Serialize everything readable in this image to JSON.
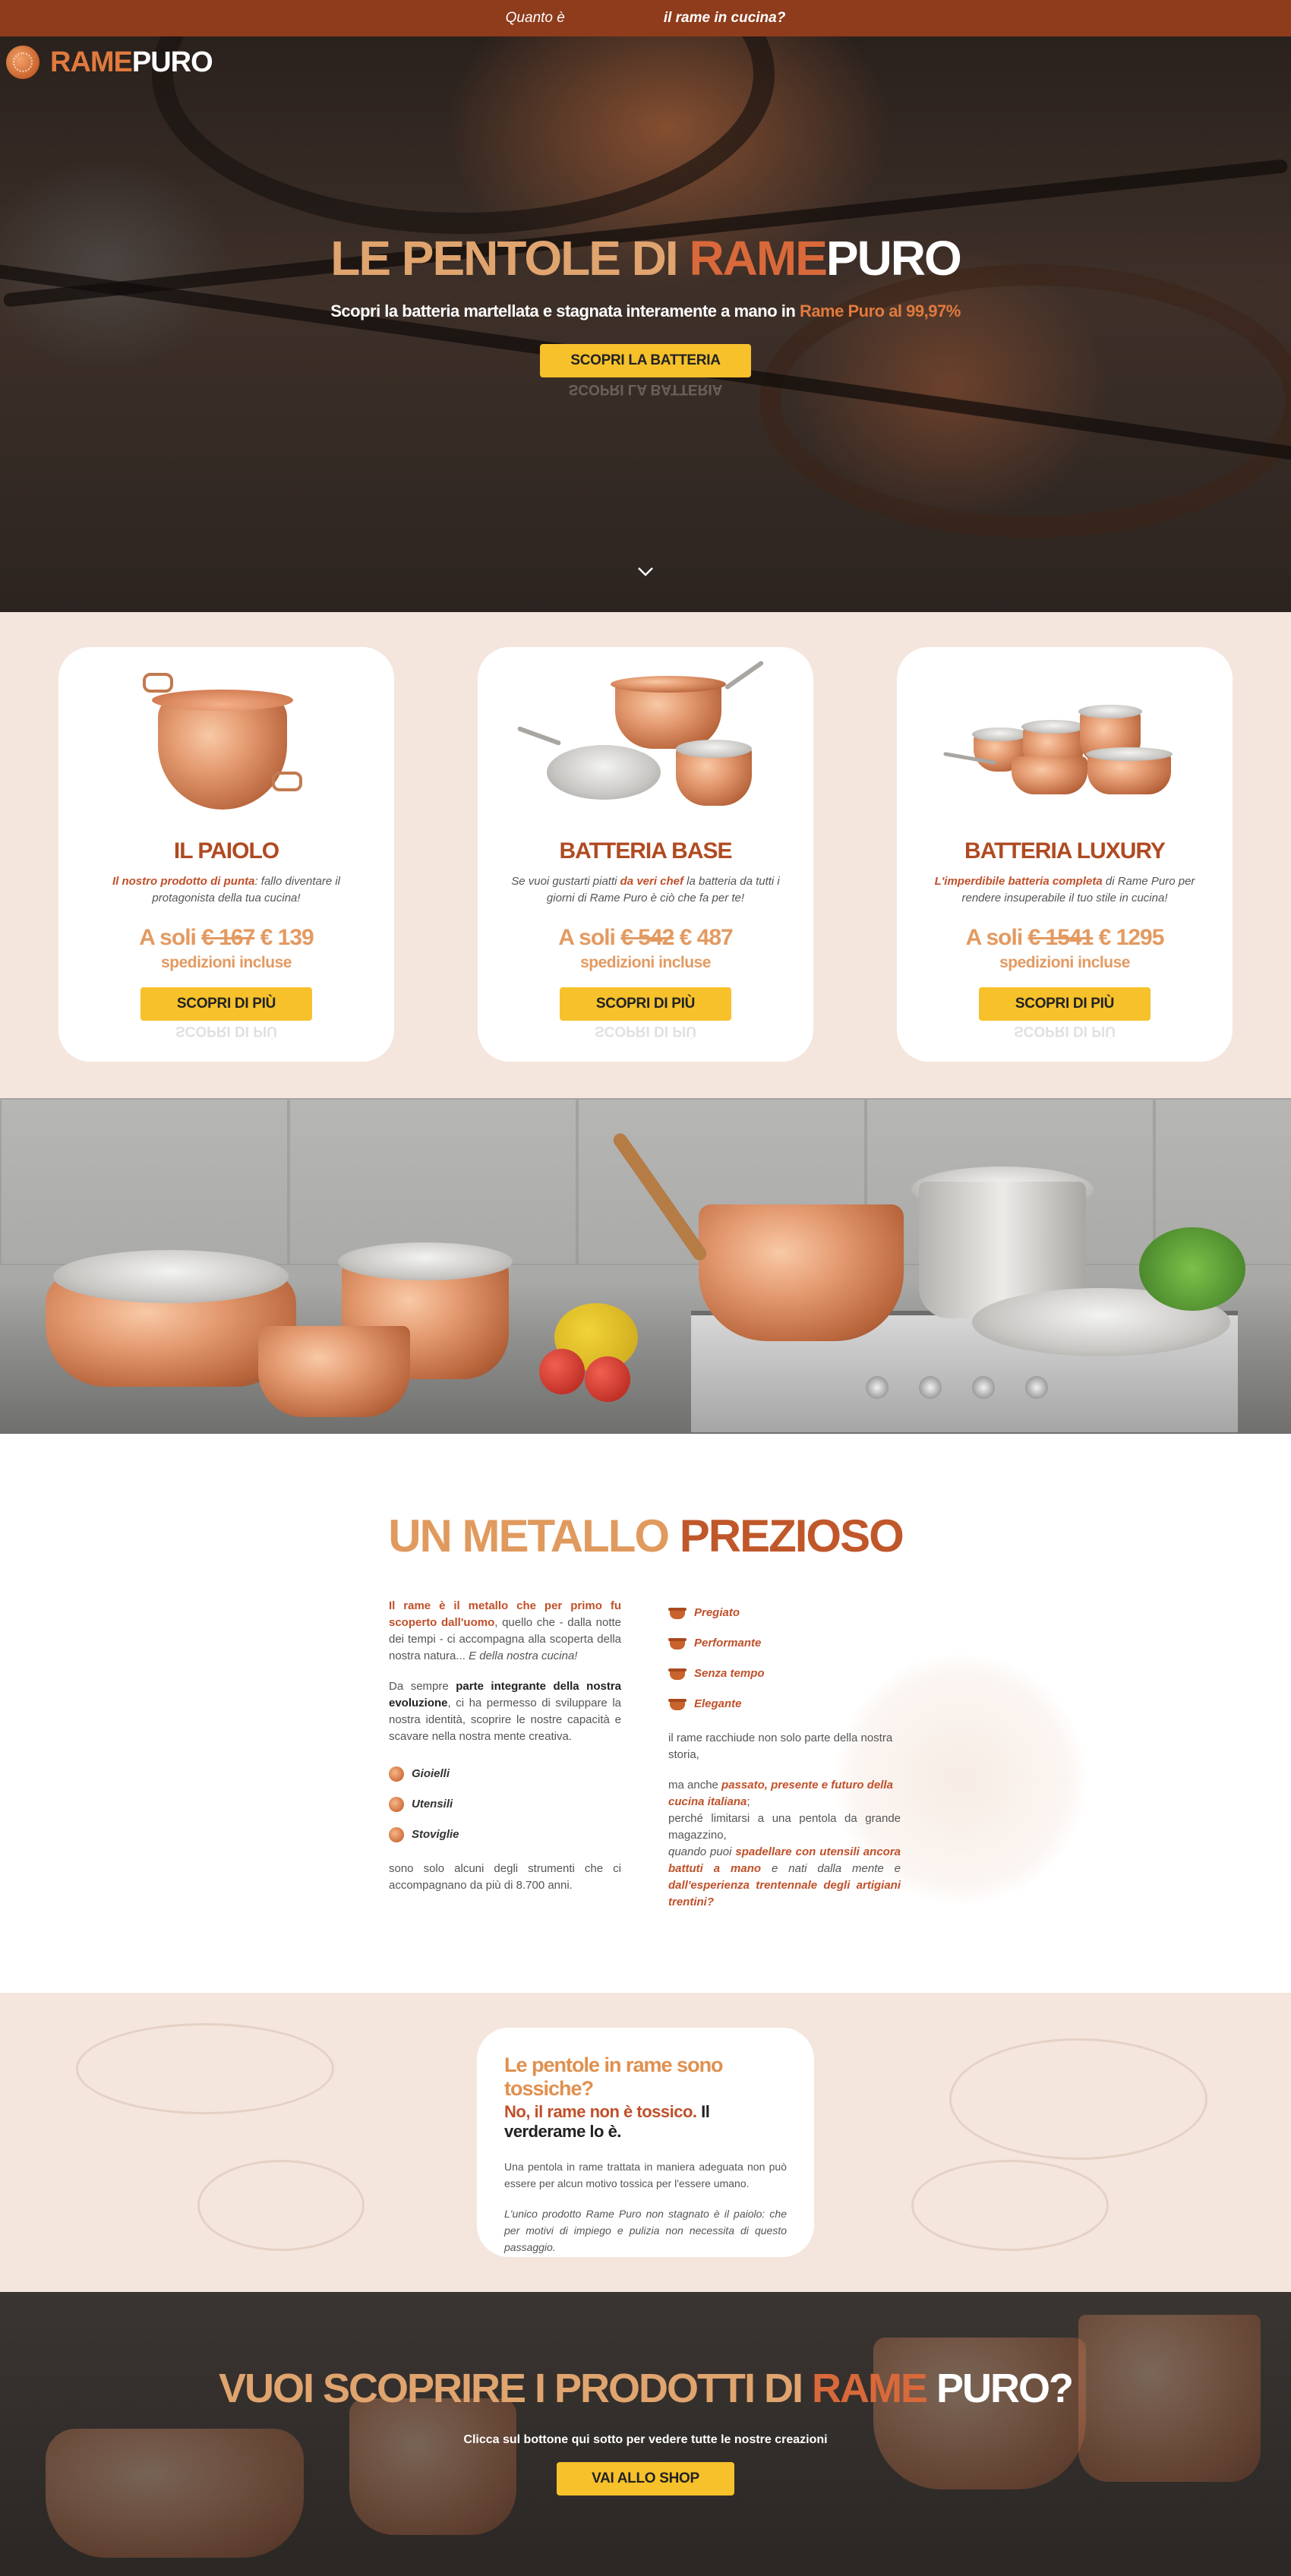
{
  "topbar": {
    "left": "Quanto è",
    "right": "il rame in cucina?"
  },
  "logo": {
    "part1": "RAME",
    "part2": "PURO"
  },
  "hero": {
    "title_1": "LE PENTOLE DI ",
    "title_2": "RAME",
    "title_3": "PURO",
    "subtitle_1": "Scopri la batteria martellata e stagnata interamente a mano in ",
    "subtitle_2": "Rame Puro al 99,97%",
    "button": "SCOPRI LA BATTERIA"
  },
  "products": [
    {
      "title": "IL PAIOLO",
      "desc_hl": "Il nostro prodotto di punta",
      "desc_rest": ": fallo diventare il protagonista della tua cucina!",
      "price_prefix": "A soli ",
      "price_old": "€ 167",
      "price_new": " € 139",
      "shipping": "spedizioni incluse",
      "button": "SCOPRI DI PIÙ"
    },
    {
      "title": "BATTERIA BASE",
      "desc_pre": "Se vuoi gustarti piatti ",
      "desc_hl": "da veri chef",
      "desc_rest": " la batteria da tutti i giorni di Rame Puro è ciò che fa per te!",
      "price_prefix": "A soli ",
      "price_old": "€ 542",
      "price_new": " € 487",
      "shipping": "spedizioni incluse",
      "button": "SCOPRI DI PIÙ"
    },
    {
      "title": "BATTERIA LUXURY",
      "desc_hl": "L'imperdibile batteria completa",
      "desc_rest": " di Rame Puro per rendere insuperabile il tuo stile in cucina!",
      "price_prefix": "A soli ",
      "price_old": "€ 1541",
      "price_new": " € 1295",
      "shipping": "spedizioni incluse",
      "button": "SCOPRI DI PIÙ"
    }
  ],
  "metallo": {
    "title_1": "UN METALLO ",
    "title_2": "PREZIOSO",
    "p1_hl": "Il rame è il metallo che per primo fu scoperto dall'uomo",
    "p1_rest": ", quello che - dalla notte dei tempi - ci accompagna alla scoperta della nostra natura... ",
    "p1_em": "E della nostra cucina!",
    "p2_pre": "Da sempre ",
    "p2_dark": "parte integrante della nostra evoluzione",
    "p2_rest": ", ci ha permesso di sviluppare la nostra identità, scoprire le nostre capacità e scavare nella nostra mente creativa.",
    "tools": [
      "Gioielli",
      "Utensili",
      "Stoviglie"
    ],
    "p3": "sono solo alcuni degli strumenti che ci accompagnano da più di 8.700 anni.",
    "qualities": [
      "Pregiato",
      "Performante",
      "Senza tempo",
      "Elegante"
    ],
    "r1": "il rame racchiude non solo parte della nostra storia,",
    "r2_pre": "ma anche ",
    "r2_hl": "passato, presente e futuro della cucina italiana",
    "r2_colon": ";",
    "r3": "perché limitarsi a una pentola da grande magazzino,",
    "r4_pre": "quando puoi ",
    "r4_hl1": "spadellare con utensili ancora battuti a mano",
    "r4_mid": " e nati dalla mente e ",
    "r4_hl2": "dall'esperienza trentennale degli artigiani trentini?"
  },
  "tossiche": {
    "title": "Le pentole in rame sono tossiche?",
    "sub_hl": "No, il rame non è tossico.",
    "sub_rest": " Il verderame lo è.",
    "p1": "Una pentola in rame trattata in maniera adeguata non può essere per alcun motivo tossica per l'essere umano.",
    "p2": "L'unico prodotto Rame Puro non stagnato è il paiolo: che per motivi di impiego e pulizia non necessita di questo passaggio."
  },
  "cta": {
    "title_1": "VUOI SCOPRIRE I PRODOTTI DI ",
    "title_2": "RAME",
    "title_3": " PURO?",
    "subtitle": "Clicca sul bottone qui sotto per vedere tutte le nostre creazioni",
    "button": "VAI ALLO SHOP"
  }
}
